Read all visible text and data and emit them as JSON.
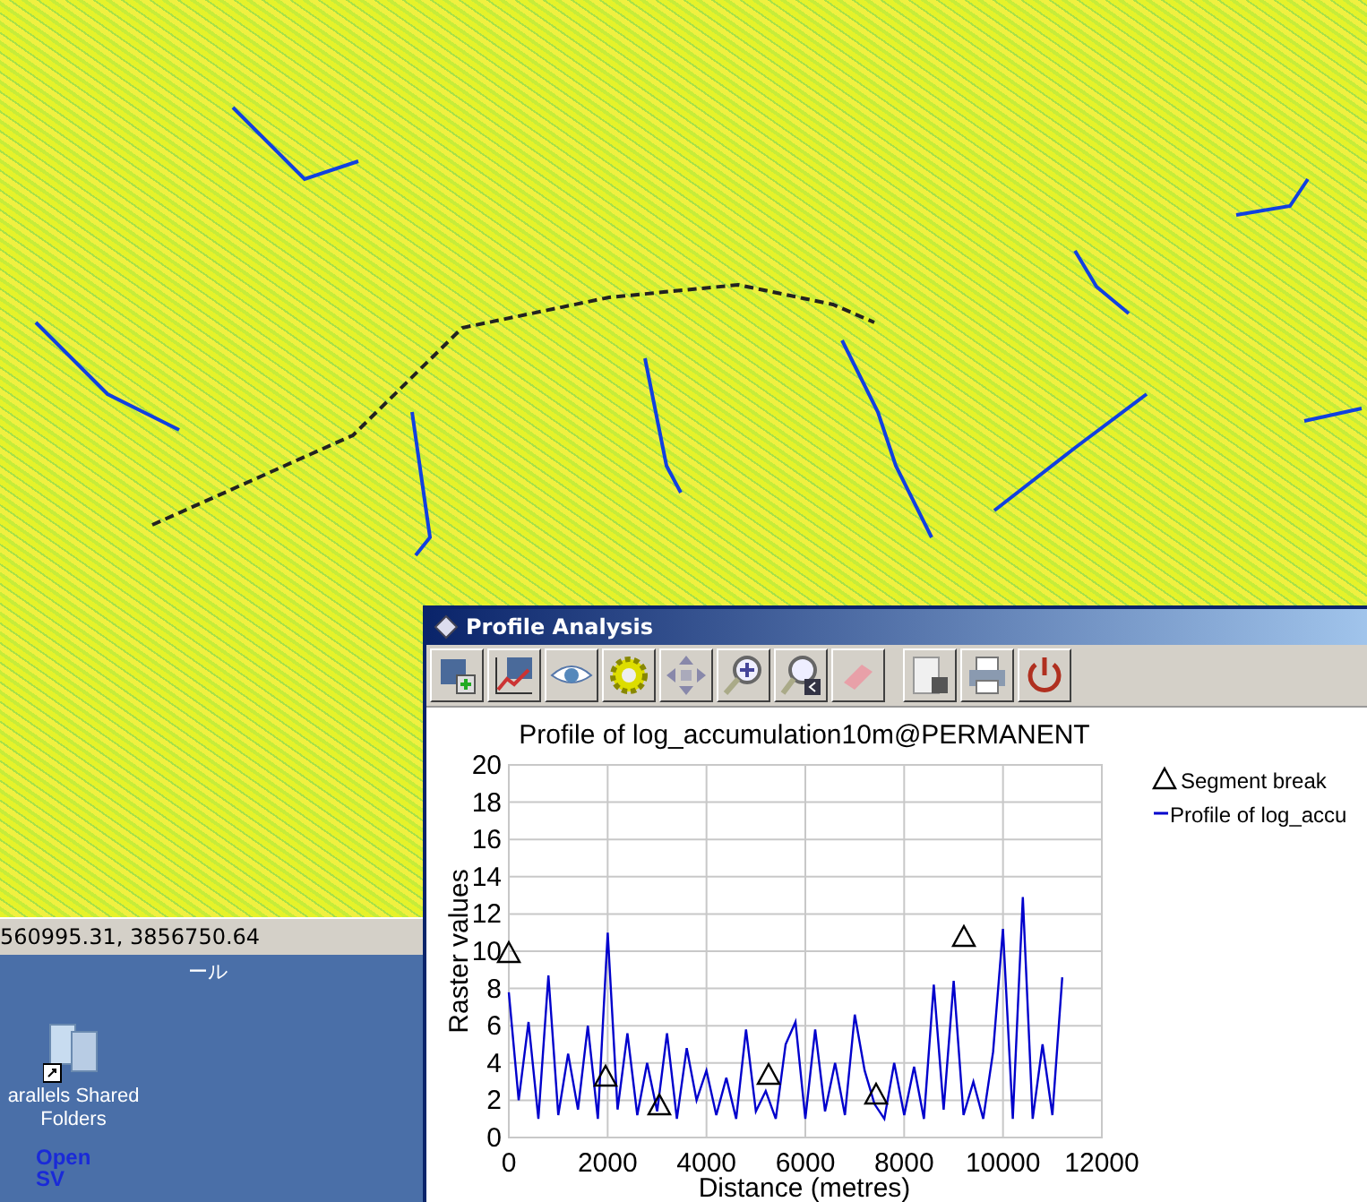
{
  "map": {
    "status_bar": {
      "coordinates": "560995.31, 3856750.64"
    }
  },
  "desktop": {
    "icons": [
      {
        "kind": "label-only",
        "label": "ール"
      },
      {
        "kind": "shared-folder",
        "label": "arallels Shared Folders"
      },
      {
        "kind": "app",
        "label": "Open SV"
      }
    ]
  },
  "profile_window": {
    "title": "Profile Analysis",
    "legend": [
      {
        "label": "Segment break"
      }
    ],
    "chart_data": {
      "type": "line",
      "title": "Profile of log_accumulation10m@PERMANENT",
      "xlabel": "Distance (metres)",
      "ylabel": "Raster values",
      "xlim": [
        0,
        12000
      ],
      "ylim": [
        0,
        20
      ],
      "grid": true,
      "xticks": [
        0,
        2000,
        4000,
        6000,
        8000,
        10000,
        12000
      ],
      "yticks": [
        0,
        2,
        4,
        6,
        8,
        10,
        12,
        14,
        16,
        18,
        20
      ],
      "x": [
        0,
        200,
        400,
        600,
        800,
        1000,
        1200,
        1400,
        1600,
        1800,
        2000,
        2200,
        2400,
        2600,
        2800,
        3000,
        3200,
        3400,
        3600,
        3800,
        4000,
        4200,
        4400,
        4600,
        4800,
        5000,
        5200,
        5400,
        5600,
        5800,
        6000,
        6200,
        6400,
        6600,
        6800,
        7000,
        7200,
        7400,
        7600,
        7800,
        8000,
        8200,
        8400,
        8600,
        8800,
        9000,
        9200,
        9400,
        9600,
        9800,
        10000,
        10200,
        10400,
        10600,
        10800,
        11000,
        11200
      ],
      "series": [
        {
          "name": "Profile of log_accu",
          "color": "#0000cc",
          "values": [
            7.8,
            2.0,
            6.2,
            1.0,
            8.7,
            1.2,
            4.5,
            1.5,
            6.0,
            1.0,
            11.0,
            1.5,
            5.6,
            1.2,
            4.0,
            1.4,
            5.6,
            1.0,
            4.8,
            2.0,
            3.6,
            1.2,
            3.2,
            1.0,
            5.8,
            1.4,
            2.5,
            1.0,
            5.0,
            6.2,
            1.0,
            5.8,
            1.4,
            4.0,
            1.2,
            6.6,
            3.6,
            1.8,
            1.0,
            4.0,
            1.2,
            3.8,
            1.0,
            8.2,
            1.5,
            8.4,
            1.2,
            3.0,
            1.0,
            4.6,
            11.2,
            1.0,
            12.9,
            1.0,
            5.0,
            1.2,
            8.6
          ]
        }
      ]
    }
  }
}
